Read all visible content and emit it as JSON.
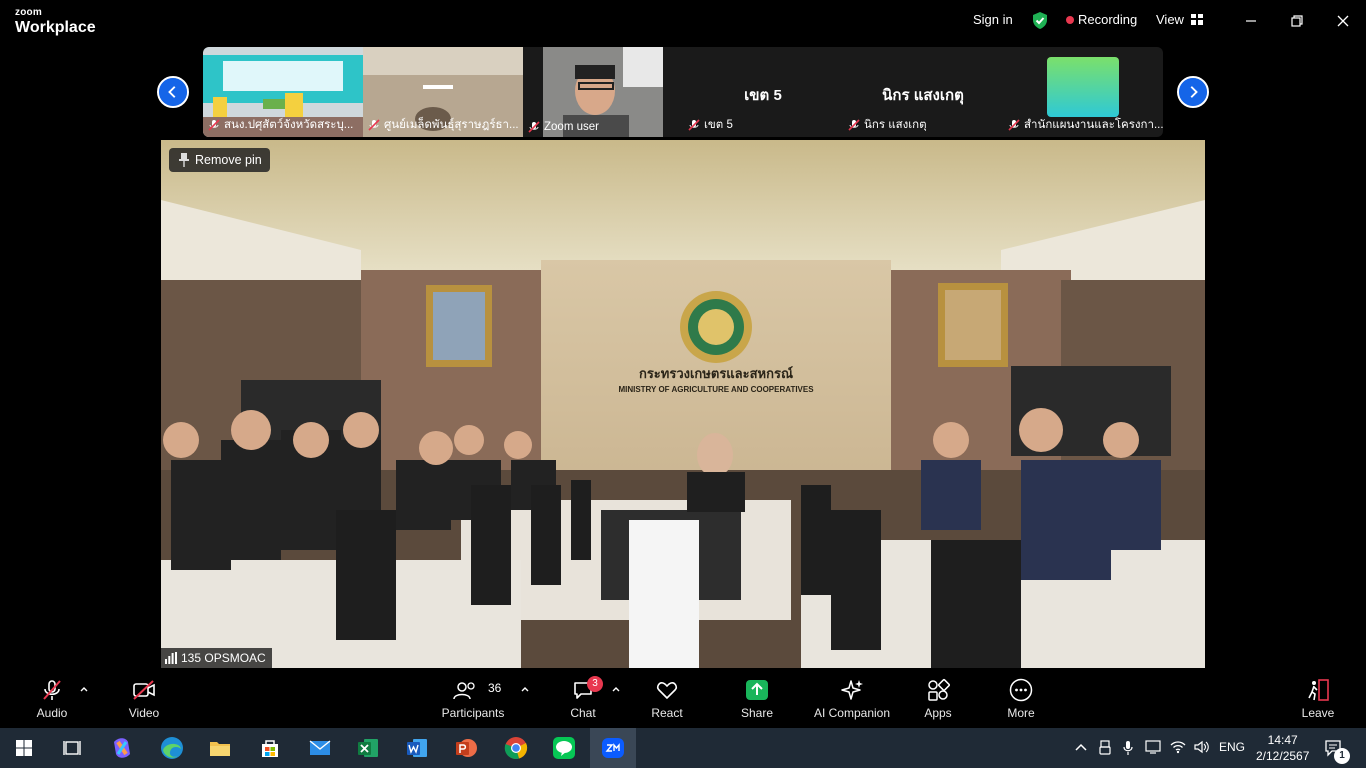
{
  "app": {
    "brand_top": "zoom",
    "brand_bottom": "Workplace"
  },
  "titlebar": {
    "sign_in": "Sign in",
    "recording": "Recording",
    "view": "View"
  },
  "thumbnails": [
    {
      "name": "สนง.ปศุสัตว์จังหวัดสระบุ...",
      "center": ""
    },
    {
      "name": "ศูนย์เมล็ดพันธุ์สุราษฎร์ธา...",
      "center": ""
    },
    {
      "name": "Zoom user",
      "center": ""
    },
    {
      "name": "เขต 5",
      "center": "เขต 5"
    },
    {
      "name": "นิกร  แสงเกตุ",
      "center": "นิกร  แสงเกตุ"
    },
    {
      "name": "สำนักแผนงานและโครงกา...",
      "center": ""
    }
  ],
  "main_video": {
    "pin_label": "Remove pin",
    "participant_name": "135 OPSMOAC",
    "sign_thai": "กระทรวงเกษตรและสหกรณ์",
    "sign_en": "MINISTRY OF AGRICULTURE AND COOPERATIVES"
  },
  "controls": {
    "audio": "Audio",
    "video": "Video",
    "participants": "Participants",
    "participants_count": "36",
    "chat": "Chat",
    "chat_badge": "3",
    "react": "React",
    "share": "Share",
    "ai_companion": "AI Companion",
    "apps": "Apps",
    "more": "More",
    "leave": "Leave"
  },
  "taskbar": {
    "language": "ENG",
    "time": "14:47",
    "date": "2/12/2567",
    "notification_count": "1",
    "apps": [
      "windows-start",
      "task-view",
      "copilot",
      "edge",
      "file-explorer",
      "store",
      "mail",
      "excel",
      "word",
      "powerpoint",
      "chrome",
      "line",
      "zoom"
    ]
  },
  "colors": {
    "accent_blue": "#1565e8",
    "record_red": "#e8384f",
    "share_green": "#19b55a",
    "shield_green": "#1fb154"
  }
}
